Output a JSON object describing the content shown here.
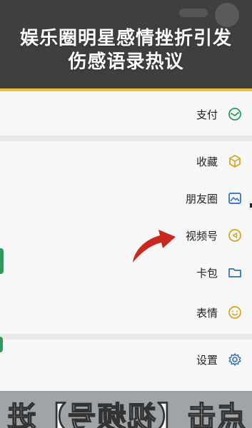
{
  "banner": {
    "headline_line1": "娱乐圈明星感情挫折引发",
    "headline_line2": "伤感语录热议"
  },
  "menu": {
    "items": [
      {
        "label": "支付",
        "icon": "payment-icon"
      },
      {
        "label": "收藏",
        "icon": "favorites-cube-icon"
      },
      {
        "label": "朋友圈",
        "icon": "moments-image-icon"
      },
      {
        "label": "视频号",
        "icon": "channels-play-icon"
      },
      {
        "label": "卡包",
        "icon": "card-folder-icon"
      },
      {
        "label": "表情",
        "icon": "sticker-smile-icon"
      },
      {
        "label": "设置",
        "icon": "settings-gear-icon"
      }
    ]
  },
  "bottom_caption": "点击【视频号】进",
  "colors": {
    "banner_bg": "#3f3f3f",
    "accent": "#e6c23a",
    "icon_green": "#2e9a5b",
    "arrow_red": "#c8281e"
  }
}
